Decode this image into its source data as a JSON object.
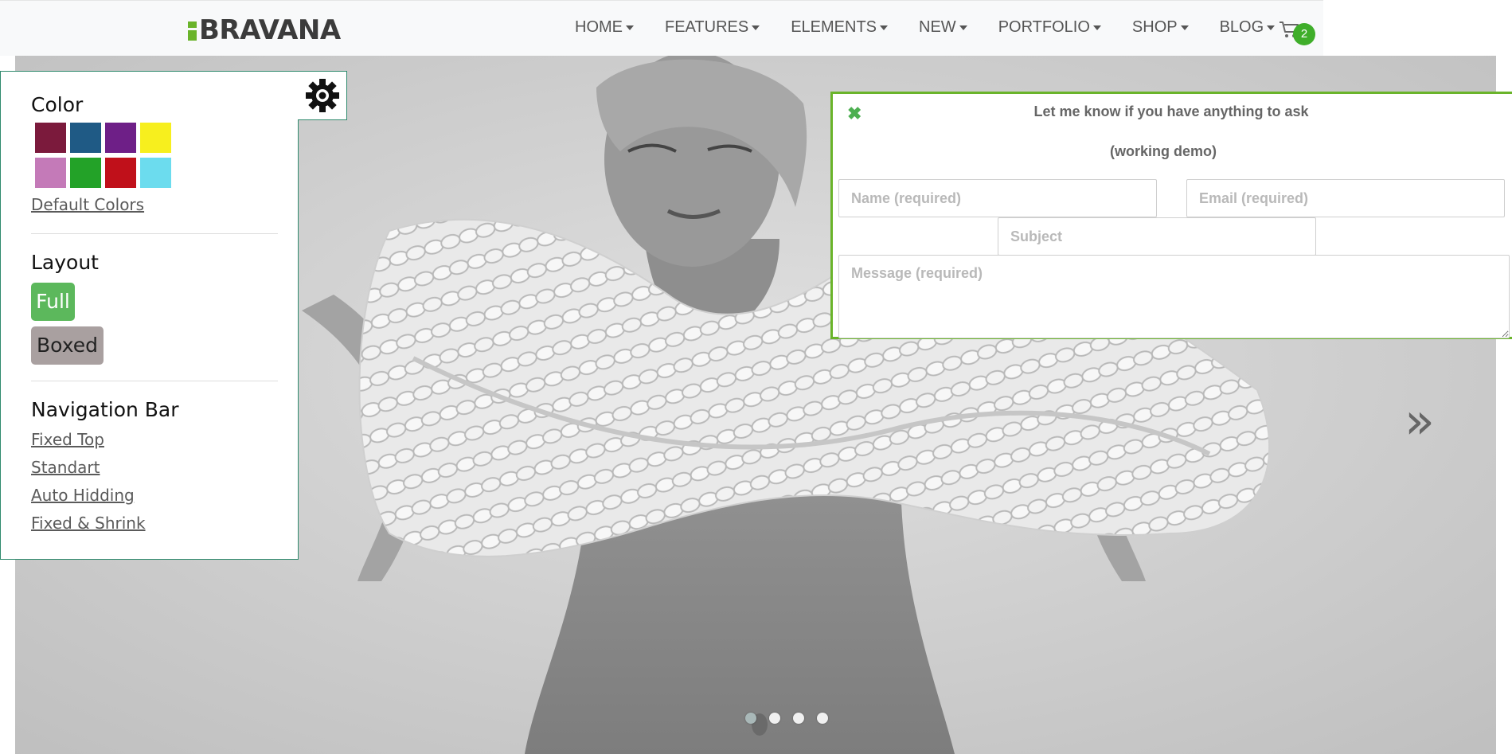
{
  "header": {
    "logo_text": "BRAVANA",
    "nav_items": [
      "HOME",
      "FEATURES",
      "ELEMENTS",
      "NEW",
      "PORTFOLIO",
      "SHOP",
      "BLOG"
    ],
    "cart_count": "2"
  },
  "slider": {
    "next_arrow": "»",
    "slide_count": 4,
    "active_slide": 1
  },
  "switcher": {
    "color_heading": "Color",
    "colors": [
      "#7b1a3c",
      "#1f5a85",
      "#6e1f87",
      "#f7ef1e",
      "#c47ab8",
      "#23a228",
      "#c0101a",
      "#6cdcee"
    ],
    "default_colors_link": "Default Colors",
    "layout_heading": "Layout",
    "layout_full": "Full",
    "layout_boxed": "Boxed",
    "navbar_heading": "Navigation Bar",
    "navbar_options": [
      "Fixed Top",
      "Standart",
      "Auto Hidding",
      "Fixed & Shrink"
    ]
  },
  "contact": {
    "title": "Let me know if you have anything to ask",
    "subtitle": "(working demo)",
    "name_placeholder": "Name (required)",
    "email_placeholder": "Email (required)",
    "subject_placeholder": "Subject",
    "message_placeholder": "Message (required)"
  },
  "colors": {
    "accent_green": "#6ab42a",
    "panel_border": "#2f8a6d",
    "full_button": "#5cb85c",
    "boxed_button": "#a9a0a0"
  }
}
